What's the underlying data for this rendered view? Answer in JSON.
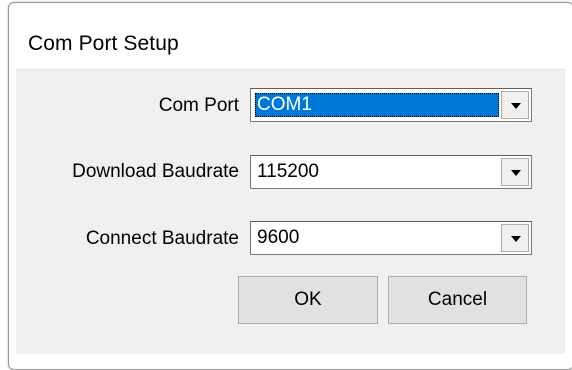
{
  "window": {
    "title": "Com Port Setup"
  },
  "fields": {
    "com_port": {
      "label": "Com Port",
      "value": "COM1"
    },
    "download_baudrate": {
      "label": "Download Baudrate",
      "value": "115200"
    },
    "connect_baudrate": {
      "label": "Connect Baudrate",
      "value": "9600"
    }
  },
  "buttons": {
    "ok_label": "OK",
    "cancel_label": "Cancel"
  },
  "icons": {
    "dropdown": "chevron-down-icon"
  },
  "colors": {
    "selection": "#0078d7",
    "dialog_background": "#f0f0f0"
  }
}
